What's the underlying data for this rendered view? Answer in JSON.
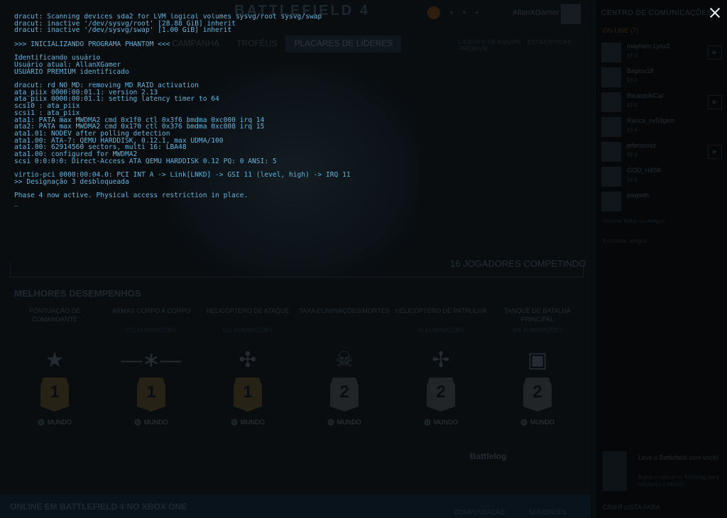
{
  "background_app": {
    "title": "BATTLEFIELD 4",
    "username": "AllanXGamer",
    "tabs": [
      {
        "label": "CAMPANHA"
      },
      {
        "label": "TROFÉUS"
      },
      {
        "label": "PLACARES DE LÍDERES",
        "active": true
      }
    ],
    "sublinks": "LÍDERES DE EQUIPE · ESTATÍSTICAS · PREMIUM",
    "players_competing": "16 JOGADORES COMPETINDO",
    "best_title": "MELHORES DESEMPENHOS",
    "cards": [
      {
        "title": "PONTUAÇÃO DE COMANDANTE",
        "icon": "★",
        "rank": "1",
        "badge": "gold",
        "world": "MUNDO"
      },
      {
        "title": "ARMAS CORPO A CORPO",
        "sub": "215 ELIMINAÇÕES",
        "icon": "—∗—",
        "rank": "1",
        "badge": "gold",
        "world": "MUNDO"
      },
      {
        "title": "HELICÓPTERO DE ATAQUE",
        "sub": "515 ELIMINAÇÕES",
        "icon": "✣",
        "rank": "1",
        "badge": "gold",
        "world": "MUNDO"
      },
      {
        "title": "TAXA ELIMINAÇÕES/MORTES",
        "icon": "☠",
        "rank": "2",
        "badge": "silver",
        "world": "MUNDO"
      },
      {
        "title": "HELICÓPTERO DE PATRULHA",
        "sub": "55 ELIMINAÇÕES",
        "icon": "✢",
        "rank": "2",
        "badge": "silver",
        "world": "MUNDO"
      },
      {
        "title": "TANQUE DE BATALHA PRINCIPAL",
        "sub": "455 ELIMINAÇÕES",
        "icon": "▣",
        "rank": "2",
        "badge": "silver",
        "world": "MUNDO"
      }
    ],
    "footer_brand": "Battlelog",
    "bottom_text": "ONLINE EM BATTLEFIELD 4 NO XBOX ONE",
    "bottom_buttons": [
      "COMPENSAÇÃO",
      "NOVIDADES"
    ]
  },
  "comms_panel": {
    "title": "CENTRO DE COMUNICAÇÕES",
    "online_label": "ON-LINE (7)",
    "friends": [
      {
        "name": "mayhem Lynx2",
        "status": "BF4"
      },
      {
        "name": "Bepinx18",
        "status": "BF4"
      },
      {
        "name": "RicardoNCar",
        "status": "BF4"
      },
      {
        "name": "Ranca_nv59gkm",
        "status": "BF4"
      },
      {
        "name": "jefersonsz",
        "status": "BF4"
      },
      {
        "name": "GOD_H4SK",
        "status": "BF4"
      },
      {
        "name": "jowpeth",
        "status": ""
      }
    ],
    "link1": "Mostrar todos os amigos",
    "link2": "Encontrar amigos",
    "ad_title": "Leve o Battlefield com você!",
    "ad_text": "Baixe o aplicativo Battlelog para celulares e tablets.",
    "bottom_label": "CRIAR LISTA PARA"
  },
  "terminal": {
    "lines": [
      "dracut: Scanning devices sda2 for LVM logical volumes sysvg/root sysvg/swap",
      "dracut: inactive '/dev/sysvg/root' [28.88 GiB] inherit",
      "dracut: inactive '/dev/sysvg/swap' [1.00 GiB] inherit",
      "",
      ">>> INICIALIZANDO PROGRAMA PHANTOM <<<",
      "",
      "Identificando usuário",
      "Usuário atual: AllanXGamer",
      "USUÁRIO PREMIUM identificado",
      "",
      "dracut: rd_NO_MD: removing MD RAID activation",
      "ata_piix 0000:00:01.1: version 2.13",
      "ata_piix 0000:00:01.1: setting latency timer to 64",
      "scsi0 : ata_piix",
      "scsi1 : ata_piix",
      "ata1: PATA max MWDMA2 cmd 0x1f0 ctl 0x3f6 bmdma 0xc000 irq 14",
      "ata2: PATA max MWDMA2 cmd 0x170 ctl 0x376 bmdma 0xc008 irq 15",
      "ata1.01: NODEV after polling detection",
      "ata1.00: ATA-7: QEMU HARDDISK, 0.12.1, max UDMA/100",
      "ata1.00: 62914560 sectors, multi 16: LBA48",
      "ata1.00: configured for MWDMA2",
      "scsi 0:0:0:0: Direct-Access ATA QEMU HARDDISK 0.12 PQ: 0 ANSI: 5",
      "",
      "virtio-pci 0000:00:04.0: PCI INT A -> Link[LNKD] -> GSI 11 (level, high) -> IRQ 11",
      ">> Designação 3 desbloqueada",
      "",
      "Phase 4 now active. Physical access restriction in place.",
      "_"
    ]
  },
  "colors": {
    "terminal_text": "#5fb4dc",
    "overlay": "#05080b",
    "close_icon": "#e8eef2"
  }
}
